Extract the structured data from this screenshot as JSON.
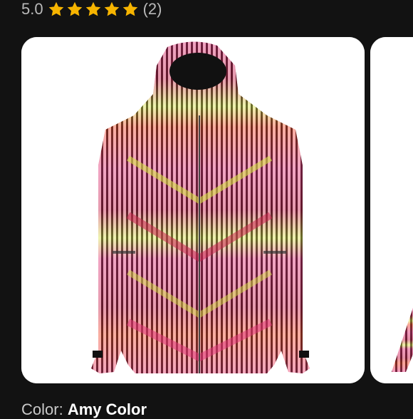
{
  "rating": {
    "score": "5.0",
    "stars_filled": 5,
    "stars_total": 5,
    "count": "(2)",
    "star_color": "#f6b400"
  },
  "gallery": {
    "images": [
      {
        "icon": "striped-snowboard-jacket-photo"
      },
      {
        "icon": "jacket-photo-partial"
      }
    ],
    "jacket_colors": [
      "#e0357a",
      "#c8224e",
      "#f24b2c",
      "#d9e54a",
      "#111111",
      "#ffffff"
    ]
  },
  "color": {
    "label": "Color:",
    "value": "Amy Color"
  }
}
